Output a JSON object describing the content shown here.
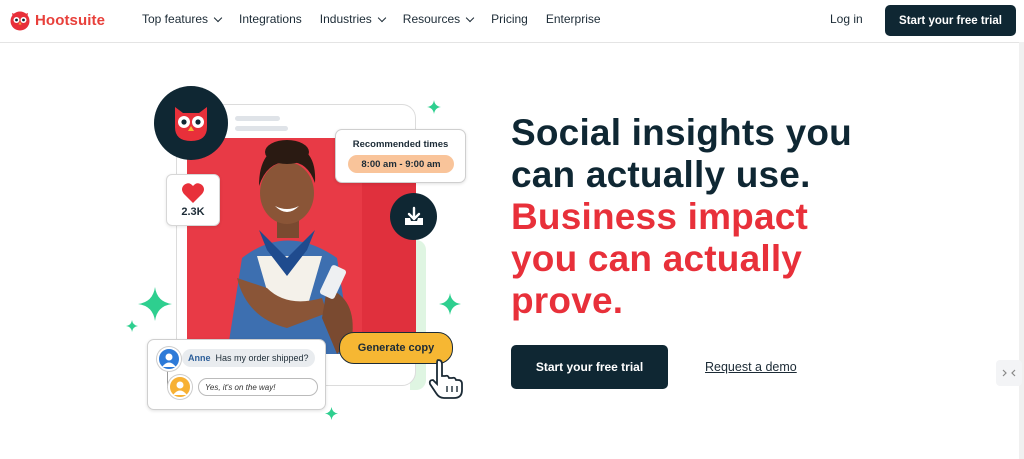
{
  "nav": {
    "logo_text": "Hootsuite",
    "links": [
      {
        "label": "Top features",
        "dropdown": true
      },
      {
        "label": "Integrations",
        "dropdown": false
      },
      {
        "label": "Industries",
        "dropdown": true
      },
      {
        "label": "Resources",
        "dropdown": true
      },
      {
        "label": "Pricing",
        "dropdown": false
      },
      {
        "label": "Enterprise",
        "dropdown": false
      }
    ],
    "login_label": "Log in",
    "cta_label": "Start your free trial"
  },
  "hero": {
    "title_lines": [
      "Social insights you",
      "can actually use."
    ],
    "title_accent_lines": [
      "Business impact",
      "you can actually",
      "prove."
    ],
    "primary_cta": "Start your free trial",
    "secondary_link": "Request a demo"
  },
  "illustration": {
    "likes_count": "2.3K",
    "recommended_title": "Recommended times",
    "recommended_time": "8:00 am - 9:00 am",
    "chat_name": "Anne",
    "chat_message": "Has my order shipped?",
    "chat_reply": "Yes, it's on the way!",
    "generate_button": "Generate copy"
  },
  "colors": {
    "brand_red": "#e8303a",
    "navy": "#0f2733",
    "accent_green": "#2ecf8f",
    "button_yellow": "#f6b733",
    "time_pill": "#f9c49a"
  },
  "icons": [
    "owl-logo-icon",
    "chevron-down-icon",
    "heart-icon",
    "download-tray-icon",
    "sparkle-icon",
    "hand-cursor-icon",
    "user-avatar-icon"
  ]
}
